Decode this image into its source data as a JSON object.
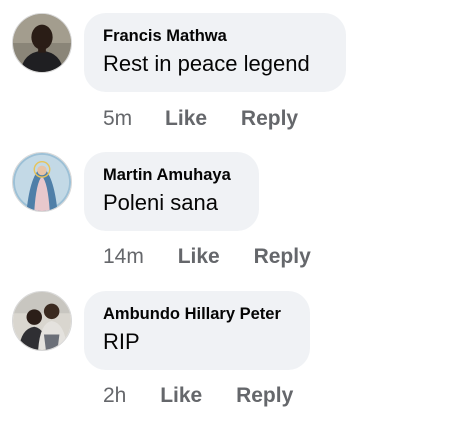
{
  "comments": [
    {
      "author": "Francis Mathwa",
      "text": "Rest in peace legend",
      "time": "5m",
      "like_label": "Like",
      "reply_label": "Reply",
      "avatar_icon": "profile-photo-man-icon"
    },
    {
      "author": "Martin Amuhaya",
      "text": "Poleni sana",
      "time": "14m",
      "like_label": "Like",
      "reply_label": "Reply",
      "avatar_icon": "profile-photo-virgin-mary-icon"
    },
    {
      "author": "Ambundo Hillary Peter",
      "text": "RIP",
      "time": "2h",
      "like_label": "Like",
      "reply_label": "Reply",
      "avatar_icon": "profile-photo-two-men-icon"
    }
  ],
  "colors": {
    "bubble_bg": "#f0f2f5",
    "text": "#050505",
    "meta": "#65676b"
  }
}
